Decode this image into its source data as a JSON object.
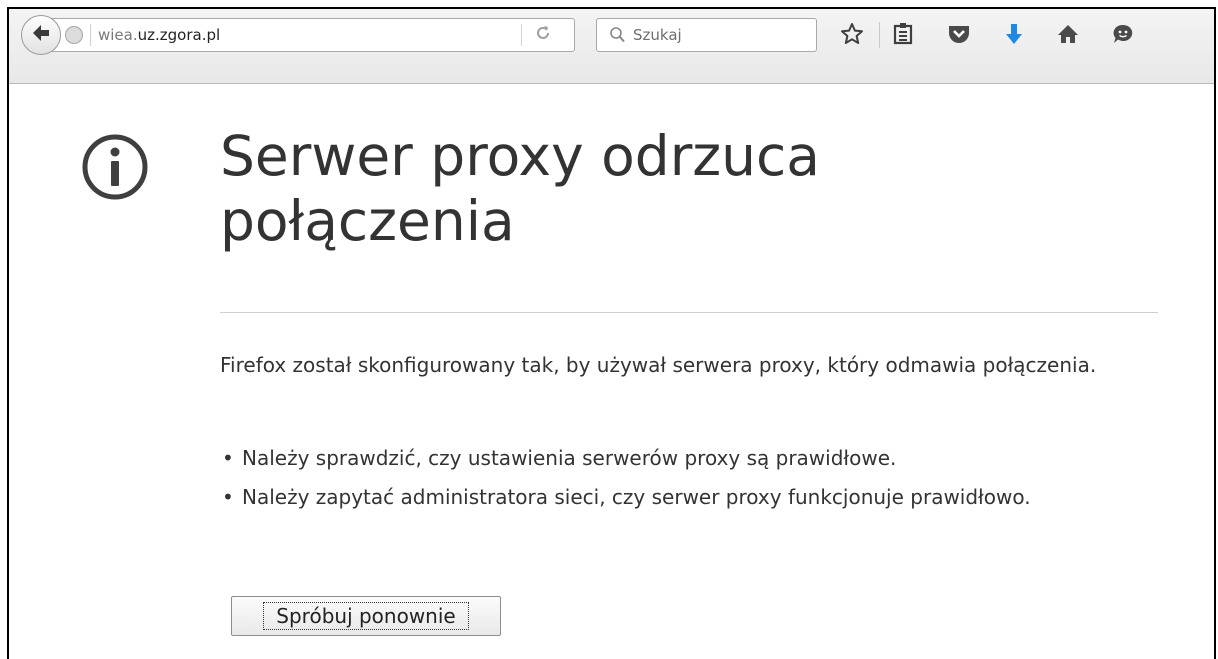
{
  "toolbar": {
    "url_prefix": "wiea.",
    "url_domain": "uz.zgora.pl",
    "search_placeholder": "Szukaj",
    "icons": [
      "back-arrow-icon",
      "globe-icon",
      "reload-icon",
      "search-icon",
      "bookmark-star-icon",
      "reading-list-icon",
      "pocket-icon",
      "download-icon",
      "home-icon",
      "chat-icon"
    ],
    "colors": {
      "download": "#1e88e5",
      "toolbar_icon": "#4a4a4a"
    }
  },
  "error_page": {
    "icon": "info-icon",
    "title": "Serwer proxy odrzuca połączenia",
    "description": "Firefox został skonfigurowany tak, by używał serwera proxy, który odmawia połączenia.",
    "suggestions": [
      "Należy sprawdzić, czy ustawienia serwerów proxy są prawidłowe.",
      "Należy zapytać administratora sieci, czy serwer proxy funkcjonuje prawidłowo."
    ],
    "retry_label": "Spróbuj ponownie"
  }
}
